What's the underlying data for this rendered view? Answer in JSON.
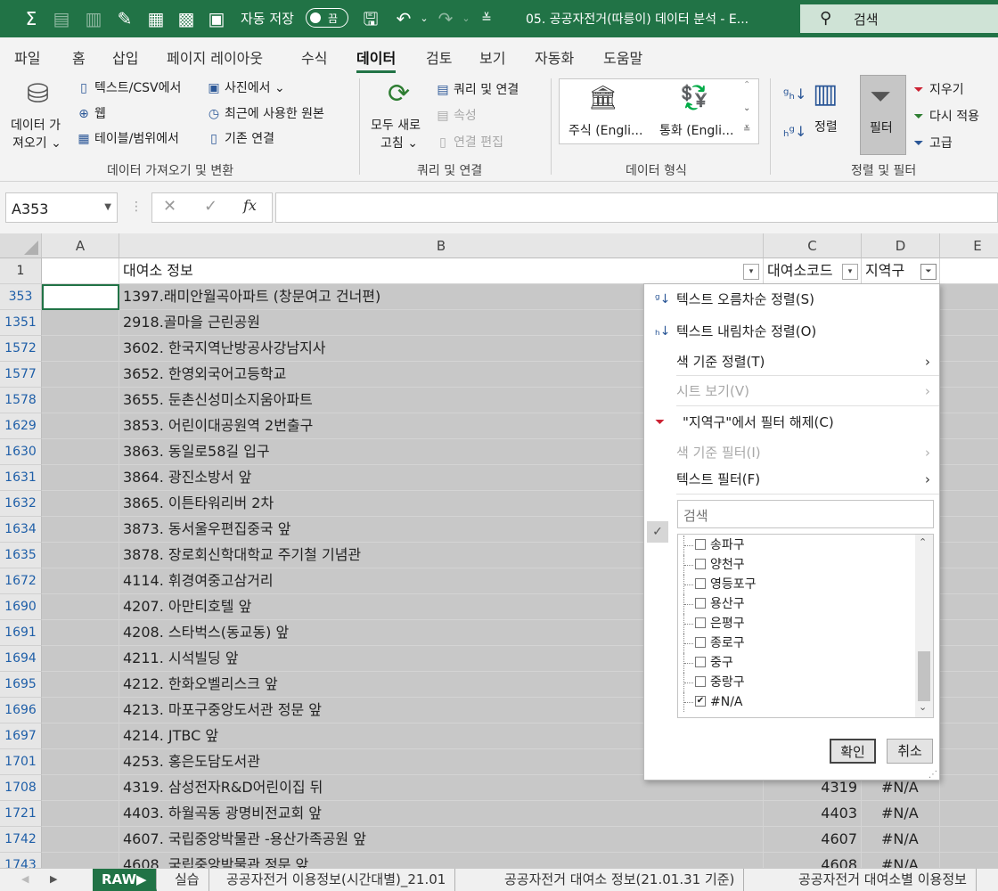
{
  "title_bar": {
    "autosave_label": "자동 저장",
    "autosave_state": "끔",
    "document_title": "05. 공공자전거(따릉이) 데이터 분석  -  E...",
    "search_placeholder": "검색",
    "quick_access_icons": [
      "sum-icon",
      "clipboard-icon",
      "page-icon",
      "edit-icon",
      "grid-icon",
      "pivot-icon",
      "frame-icon",
      "save-icon",
      "undo-icon",
      "redo-icon",
      "customize-icon"
    ]
  },
  "ribbon_tabs": [
    "파일",
    "홈",
    "삽입",
    "페이지 레이아웃",
    "수식",
    "데이터",
    "검토",
    "보기",
    "자동화",
    "도움말"
  ],
  "active_tab": "데이터",
  "ribbon": {
    "get_data_l1": "데이터 가",
    "get_data_l2": "져오기 ⌄",
    "text_csv": "텍스트/CSV에서",
    "web": "웹",
    "table_range": "테이블/범위에서",
    "from_picture": "사진에서 ⌄",
    "recent_sources": "최근에 사용한 원본",
    "existing_conn": "기존 연결",
    "group_get_transform": "데이터 가져오기 및 변환",
    "refresh_l1": "모두 새로",
    "refresh_l2": "고침 ⌄",
    "queries_conn": "쿼리 및 연결",
    "properties": "속성",
    "edit_links": "연결 편집",
    "group_queries": "쿼리 및 연결",
    "stocks": "주식 (Engli...",
    "currencies": "통화 (Engli...",
    "group_datatypes": "데이터 형식",
    "sort_btn": "정렬",
    "filter_btn": "필터",
    "clear": "지우기",
    "reapply": "다시 적용",
    "advanced": "고급",
    "group_sort_filter": "정렬 및 필터"
  },
  "formula_bar": {
    "name_box": "A353",
    "fx": "fx",
    "formula": ""
  },
  "columns": [
    "A",
    "B",
    "C",
    "D",
    "E"
  ],
  "header_row": {
    "row": "1",
    "b": "대여소 정보",
    "c": "대여소코드",
    "d": "지역구"
  },
  "rows": [
    {
      "row": "353",
      "b": "1397.래미안월곡아파트 (창문여고 건너편)",
      "c": "",
      "d": ""
    },
    {
      "row": "1351",
      "b": "2918.골마을 근린공원",
      "c": "",
      "d": ""
    },
    {
      "row": "1572",
      "b": "3602. 한국지역난방공사강남지사",
      "c": "",
      "d": ""
    },
    {
      "row": "1577",
      "b": "3652. 한영외국어고등학교",
      "c": "",
      "d": ""
    },
    {
      "row": "1578",
      "b": "3655. 둔촌신성미소지움아파트",
      "c": "",
      "d": ""
    },
    {
      "row": "1629",
      "b": "3853. 어린이대공원역 2번출구",
      "c": "",
      "d": ""
    },
    {
      "row": "1630",
      "b": "3863. 동일로58길 입구",
      "c": "",
      "d": ""
    },
    {
      "row": "1631",
      "b": "3864. 광진소방서 앞",
      "c": "",
      "d": ""
    },
    {
      "row": "1632",
      "b": "3865. 이튼타워리버 2차",
      "c": "",
      "d": ""
    },
    {
      "row": "1634",
      "b": "3873. 동서울우편집중국 앞",
      "c": "",
      "d": ""
    },
    {
      "row": "1635",
      "b": "3878. 장로회신학대학교 주기철 기념관",
      "c": "",
      "d": ""
    },
    {
      "row": "1672",
      "b": "4114. 휘경여중고삼거리",
      "c": "",
      "d": ""
    },
    {
      "row": "1690",
      "b": "4207. 아만티호텔 앞",
      "c": "",
      "d": ""
    },
    {
      "row": "1691",
      "b": "4208. 스타벅스(동교동) 앞",
      "c": "",
      "d": ""
    },
    {
      "row": "1694",
      "b": "4211. 시석빌딩 앞",
      "c": "",
      "d": ""
    },
    {
      "row": "1695",
      "b": "4212. 한화오벨리스크 앞",
      "c": "",
      "d": ""
    },
    {
      "row": "1696",
      "b": "4213. 마포구중앙도서관 정문 앞",
      "c": "",
      "d": ""
    },
    {
      "row": "1697",
      "b": "4214. JTBC 앞",
      "c": "",
      "d": ""
    },
    {
      "row": "1701",
      "b": "4253. 홍은도담도서관",
      "c": "",
      "d": ""
    },
    {
      "row": "1708",
      "b": "4319. 삼성전자R&D어린이집 뒤",
      "c": "4319",
      "d": "#N/A"
    },
    {
      "row": "1721",
      "b": "4403. 하월곡동 광명비전교회 앞",
      "c": "4403",
      "d": "#N/A"
    },
    {
      "row": "1742",
      "b": "4607. 국립중앙박물관 -용산가족공원 앞",
      "c": "4607",
      "d": "#N/A"
    },
    {
      "row": "1743",
      "b": "4608. 국립중앙박물관 정문 앞",
      "c": "4608",
      "d": "#N/A"
    }
  ],
  "filter_panel": {
    "sort_asc": "텍스트 오름차순 정렬(S)",
    "sort_desc": "텍스트 내림차순 정렬(O)",
    "sort_by_color": "색 기준 정렬(T)",
    "sheet_view": "시트 보기(V)",
    "clear_filter": "\"지역구\"에서 필터 해제(C)",
    "filter_by_color": "색 기준 필터(I)",
    "text_filters": "텍스트 필터(F)",
    "search_placeholder": "검색",
    "items": [
      {
        "label": "송파구",
        "checked": false
      },
      {
        "label": "양천구",
        "checked": false
      },
      {
        "label": "영등포구",
        "checked": false
      },
      {
        "label": "용산구",
        "checked": false
      },
      {
        "label": "은평구",
        "checked": false
      },
      {
        "label": "종로구",
        "checked": false
      },
      {
        "label": "중구",
        "checked": false
      },
      {
        "label": "중랑구",
        "checked": false
      },
      {
        "label": "#N/A",
        "checked": true
      }
    ],
    "ok": "확인",
    "cancel": "취소"
  },
  "sheet_tabs": [
    "RAW▶",
    "실습",
    "공공자전거 이용정보(시간대별)_21.01",
    "공공자전거 대여소 정보(21.01.31 기준)",
    "공공자전거 대여소별 이용정보"
  ],
  "active_sheet": "RAW▶",
  "colors": {
    "excel_green": "#217346",
    "selection_gray": "#c8c8c8",
    "row_number_blue": "#1f5fa8"
  }
}
